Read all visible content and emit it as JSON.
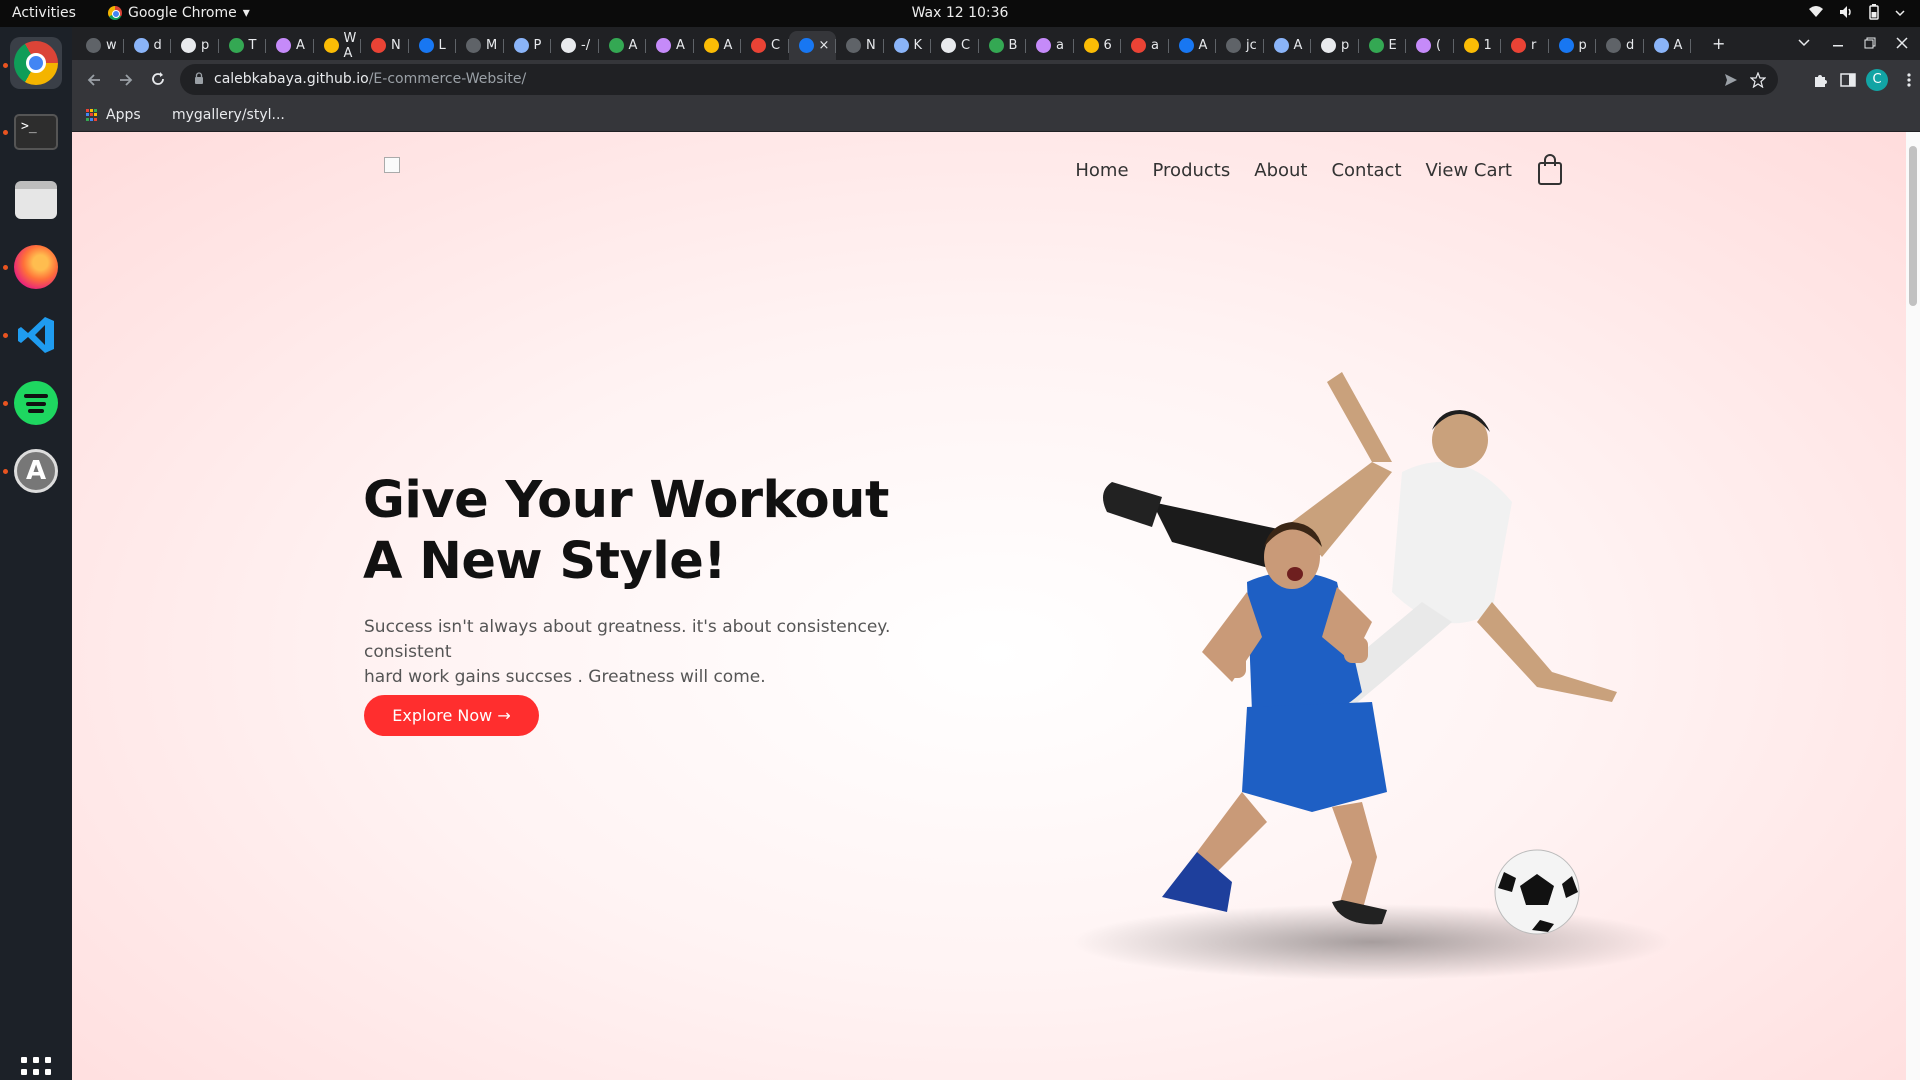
{
  "system": {
    "activities": "Activities",
    "app_name": "Google Chrome",
    "app_menu_arrow": "▾",
    "clock": "Wax 12  10:36"
  },
  "dock": {
    "apps": [
      "chrome",
      "terminal",
      "files",
      "firefox",
      "vscode",
      "spotify",
      "software-center"
    ],
    "terminal_prompt": ">_"
  },
  "browser": {
    "tabs": [
      {
        "label": "w"
      },
      {
        "label": "d"
      },
      {
        "label": "p"
      },
      {
        "label": "T"
      },
      {
        "label": "A"
      },
      {
        "label": "W A"
      },
      {
        "label": "N"
      },
      {
        "label": "L"
      },
      {
        "label": "M"
      },
      {
        "label": "P"
      },
      {
        "label": "-/"
      },
      {
        "label": "A"
      },
      {
        "label": "A"
      },
      {
        "label": "A"
      },
      {
        "label": "C"
      },
      {
        "label": "×"
      },
      {
        "label": "N"
      },
      {
        "label": "K"
      },
      {
        "label": "C"
      },
      {
        "label": "B"
      },
      {
        "label": "a"
      },
      {
        "label": "6"
      },
      {
        "label": "a"
      },
      {
        "label": "A"
      },
      {
        "label": "jc"
      },
      {
        "label": "A"
      },
      {
        "label": "p"
      },
      {
        "label": "E"
      },
      {
        "label": "("
      },
      {
        "label": "1"
      },
      {
        "label": "r"
      },
      {
        "label": "p"
      },
      {
        "label": "d"
      },
      {
        "label": "A"
      }
    ],
    "new_tab": "+",
    "url_host": "calebkabaya.github.io",
    "url_path": "/E-commerce-Website/",
    "profile_initial": "C",
    "bookmarks": [
      {
        "label": "Apps"
      },
      {
        "label": "mygallery/styl..."
      }
    ]
  },
  "page": {
    "nav": {
      "home": "Home",
      "products": "Products",
      "about": "About",
      "contact": "Contact",
      "view_cart": "View Cart"
    },
    "hero": {
      "title_line1": "Give Your Workout",
      "title_line2": "A New Style!",
      "subtitle_line1": "Success isn't always about greatness. it's about consistencey. consistent",
      "subtitle_line2": "hard work gains succses . Greatness will come.",
      "cta": "Explore Now →"
    },
    "colors": {
      "cta_bg": "#ff2e2e",
      "page_bg_edge": "#ffdcdc",
      "jersey_blue": "#1e5fc4"
    }
  }
}
